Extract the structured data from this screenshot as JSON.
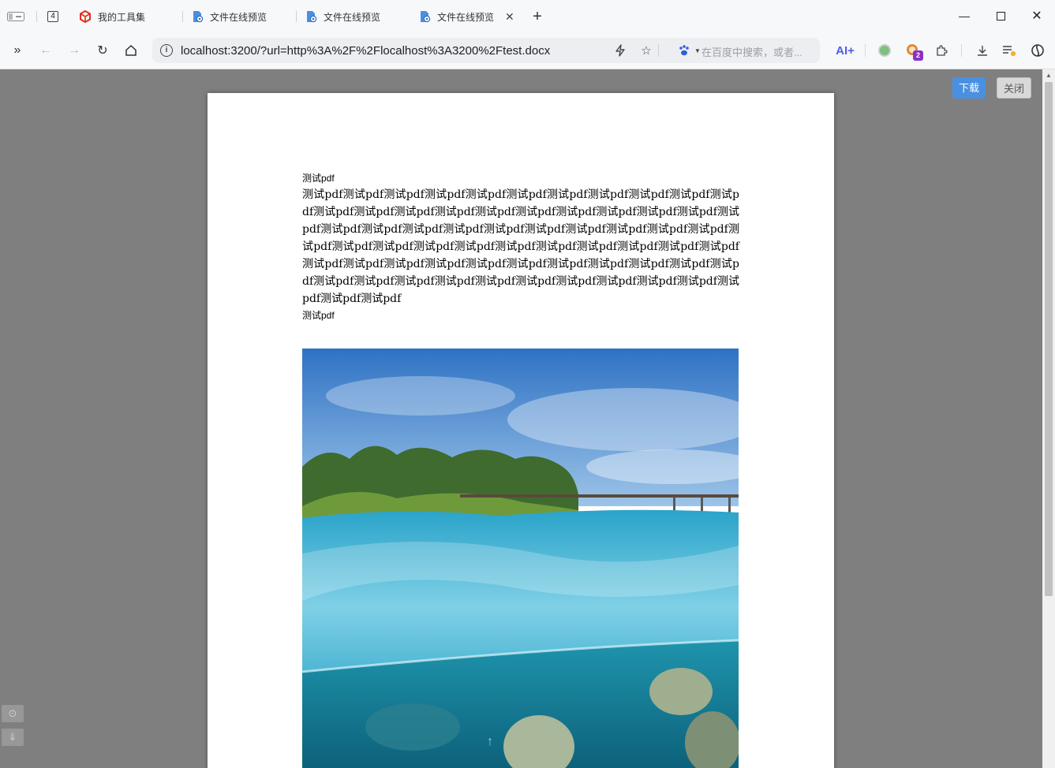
{
  "browser": {
    "tab_count": "4",
    "tabs": [
      {
        "label": "我的工具集"
      },
      {
        "label": "文件在线预览"
      },
      {
        "label": "文件在线预览"
      },
      {
        "label": "文件在线预览",
        "active": true
      }
    ],
    "new_tab": "+",
    "url": "localhost:3200/?url=http%3A%2F%2Flocalhost%3A3200%2Ftest.docx",
    "search_placeholder": "在百度中搜索，或者...",
    "ai_label": "AI+",
    "extension_badge": "2"
  },
  "viewer": {
    "download_label": "下载",
    "close_label": "关闭"
  },
  "document": {
    "line1": "测试pdf",
    "paragraph": "测试pdf测试pdf测试pdf测试pdf测试pdf测试pdf测试pdf测试pdf测试pdf测试pdf测试pdf测试pdf测试pdf测试pdf测试pdf测试pdf测试pdf测试pdf测试pdf测试pdf测试pdf测试pdf测试pdf测试pdf测试pdf测试pdf测试pdf测试pdf测试pdf测试pdf测试pdf测试pdf测试pdf测试pdf测试pdf测试pdf测试pdf测试pdf测试pdf测试pdf测试pdf测试pdf测试pdf测试pdf测试pdf测试pdf测试pdf测试pdf测试pdf测试pdf测试pdf测试pdf测试pdf测试pdf测试pdf测试pdf测试pdf测试pdf测试pdf测试pdf测试pdf测试pdf测试pdf测试pdf测试pdf测试pdf测试pdf",
    "line3": "测试pdf"
  },
  "colors": {
    "viewer_background": "#7f7f7f",
    "download_button": "#4a90e2",
    "close_button": "#d8d8d8"
  }
}
